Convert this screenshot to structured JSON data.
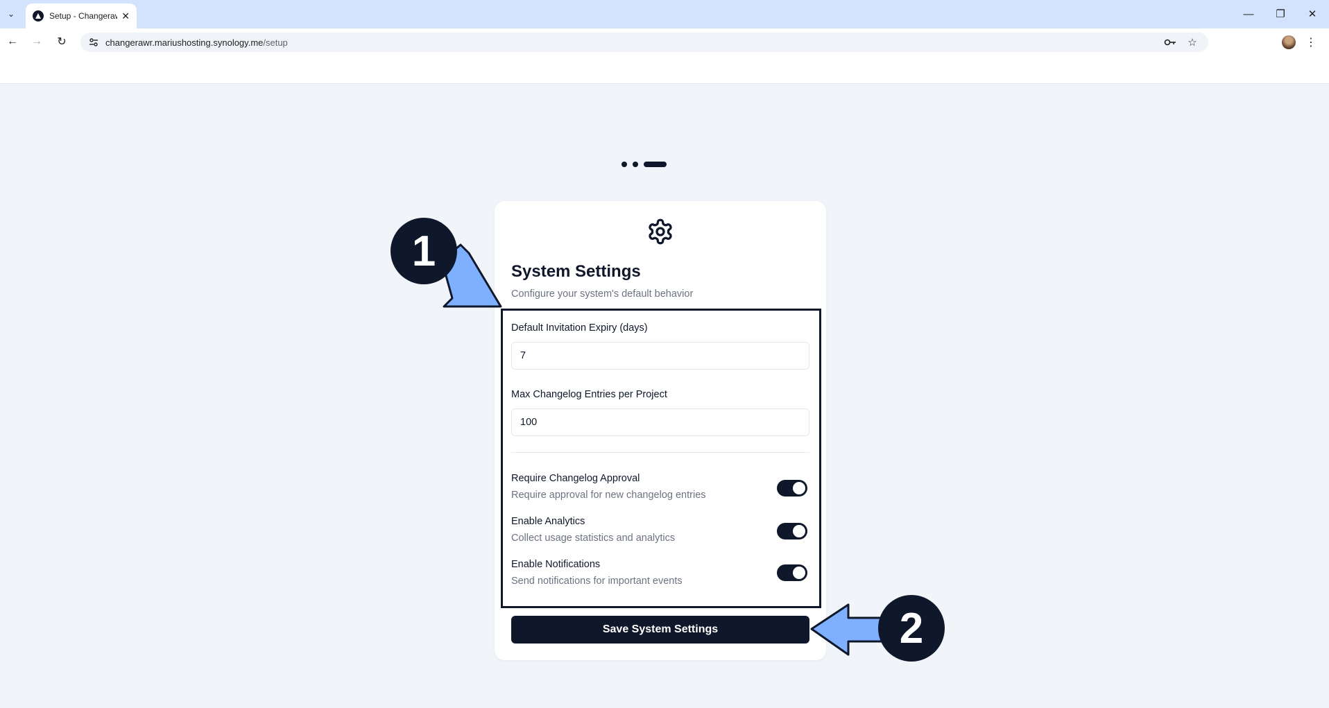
{
  "browser": {
    "tab_title": "Setup - Changerawr",
    "url_host": "changerawr.mariushosting.synology.me",
    "url_path": "/setup"
  },
  "setup": {
    "title": "System Settings",
    "subtitle": "Configure your system's default behavior",
    "fields": [
      {
        "label": "Default Invitation Expiry (days)",
        "value": "7"
      },
      {
        "label": "Max Changelog Entries per Project",
        "value": "100"
      }
    ],
    "toggles": [
      {
        "title": "Require Changelog Approval",
        "description": "Require approval for new changelog entries",
        "on": true
      },
      {
        "title": "Enable Analytics",
        "description": "Collect usage statistics and analytics",
        "on": true
      },
      {
        "title": "Enable Notifications",
        "description": "Send notifications for important events",
        "on": true
      }
    ],
    "save_label": "Save System Settings"
  },
  "annotations": {
    "badge_1": "1",
    "badge_2": "2",
    "arrow_color": "#7fb0ff"
  },
  "colors": {
    "primary": "#0f172a",
    "page_bg": "#f1f4f8",
    "tabstrip_bg": "#d3e3fd"
  }
}
